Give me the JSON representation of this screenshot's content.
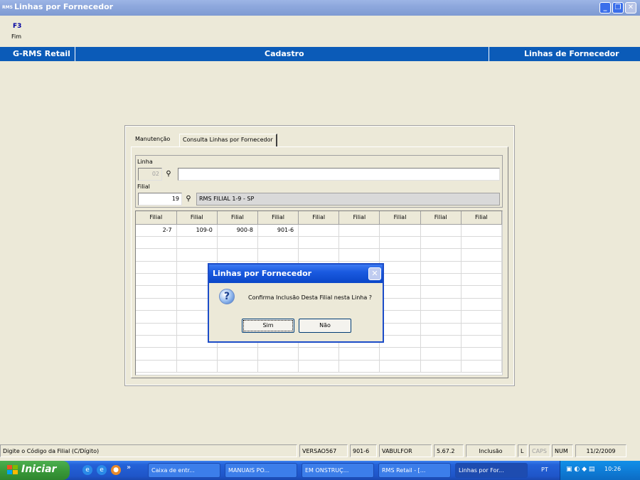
{
  "window": {
    "title": "Linhas por Fornecedor",
    "app_icon_text": "RMS"
  },
  "toolbar": {
    "fkey": "F3",
    "fkey_label": "Fim"
  },
  "header": {
    "left": "G-RMS Retail",
    "center": "Cadastro",
    "right": "Linhas de Fornecedor"
  },
  "tabs": [
    {
      "label": "Manutenção",
      "active": true
    },
    {
      "label": "Consulta Linhas por Fornecedor",
      "active": false
    }
  ],
  "form": {
    "linha_label": "Linha",
    "linha_value": "02",
    "linha_desc": "",
    "filial_label": "Filial",
    "filial_value": "19",
    "filial_desc": "RMS FILIAL 1-9 - SP"
  },
  "grid": {
    "columns": [
      "Filial",
      "Filial",
      "Filial",
      "Filial",
      "Filial",
      "Filial",
      "Filial",
      "Filial",
      "Filial"
    ],
    "rows": [
      [
        "2-7",
        "109-0",
        "900-8",
        "901-6",
        "",
        "",
        "",
        "",
        ""
      ]
    ]
  },
  "dialog": {
    "title": "Linhas por Fornecedor",
    "message": "Confirma Inclusão Desta Filial nesta Linha ?",
    "yes_label": "Sim",
    "no_label": "Não",
    "icon": "question-icon"
  },
  "statusbar": {
    "hint": "Digite o Código da Filial (C/Dígito)",
    "version": "VERSAO567",
    "code": "901-6",
    "program": "VABULFOR",
    "build": "5.67.2",
    "mode": "Inclusão",
    "l": "L",
    "caps": "CAPS",
    "num": "NUM",
    "date": "11/2/2009"
  },
  "taskbar": {
    "start_label": "Iniciar",
    "quicklaunch_more": "»",
    "tasks": [
      {
        "label": "Caixa de entr...",
        "active": false
      },
      {
        "label": "MANUAIS PO...",
        "active": false
      },
      {
        "label": "EM ONSTRUÇ...",
        "active": false
      },
      {
        "label": "RMS Retail - [...",
        "active": false
      },
      {
        "label": "Linhas por For...",
        "active": true
      }
    ],
    "language": "PT",
    "clock": "10:26"
  },
  "colors": {
    "header_bg": "#0B5BB8",
    "titlebar": "#8EA8DD",
    "dialog_title": "#1A5AE0",
    "taskbar": "#2462D8",
    "start": "#3A9A3A"
  }
}
